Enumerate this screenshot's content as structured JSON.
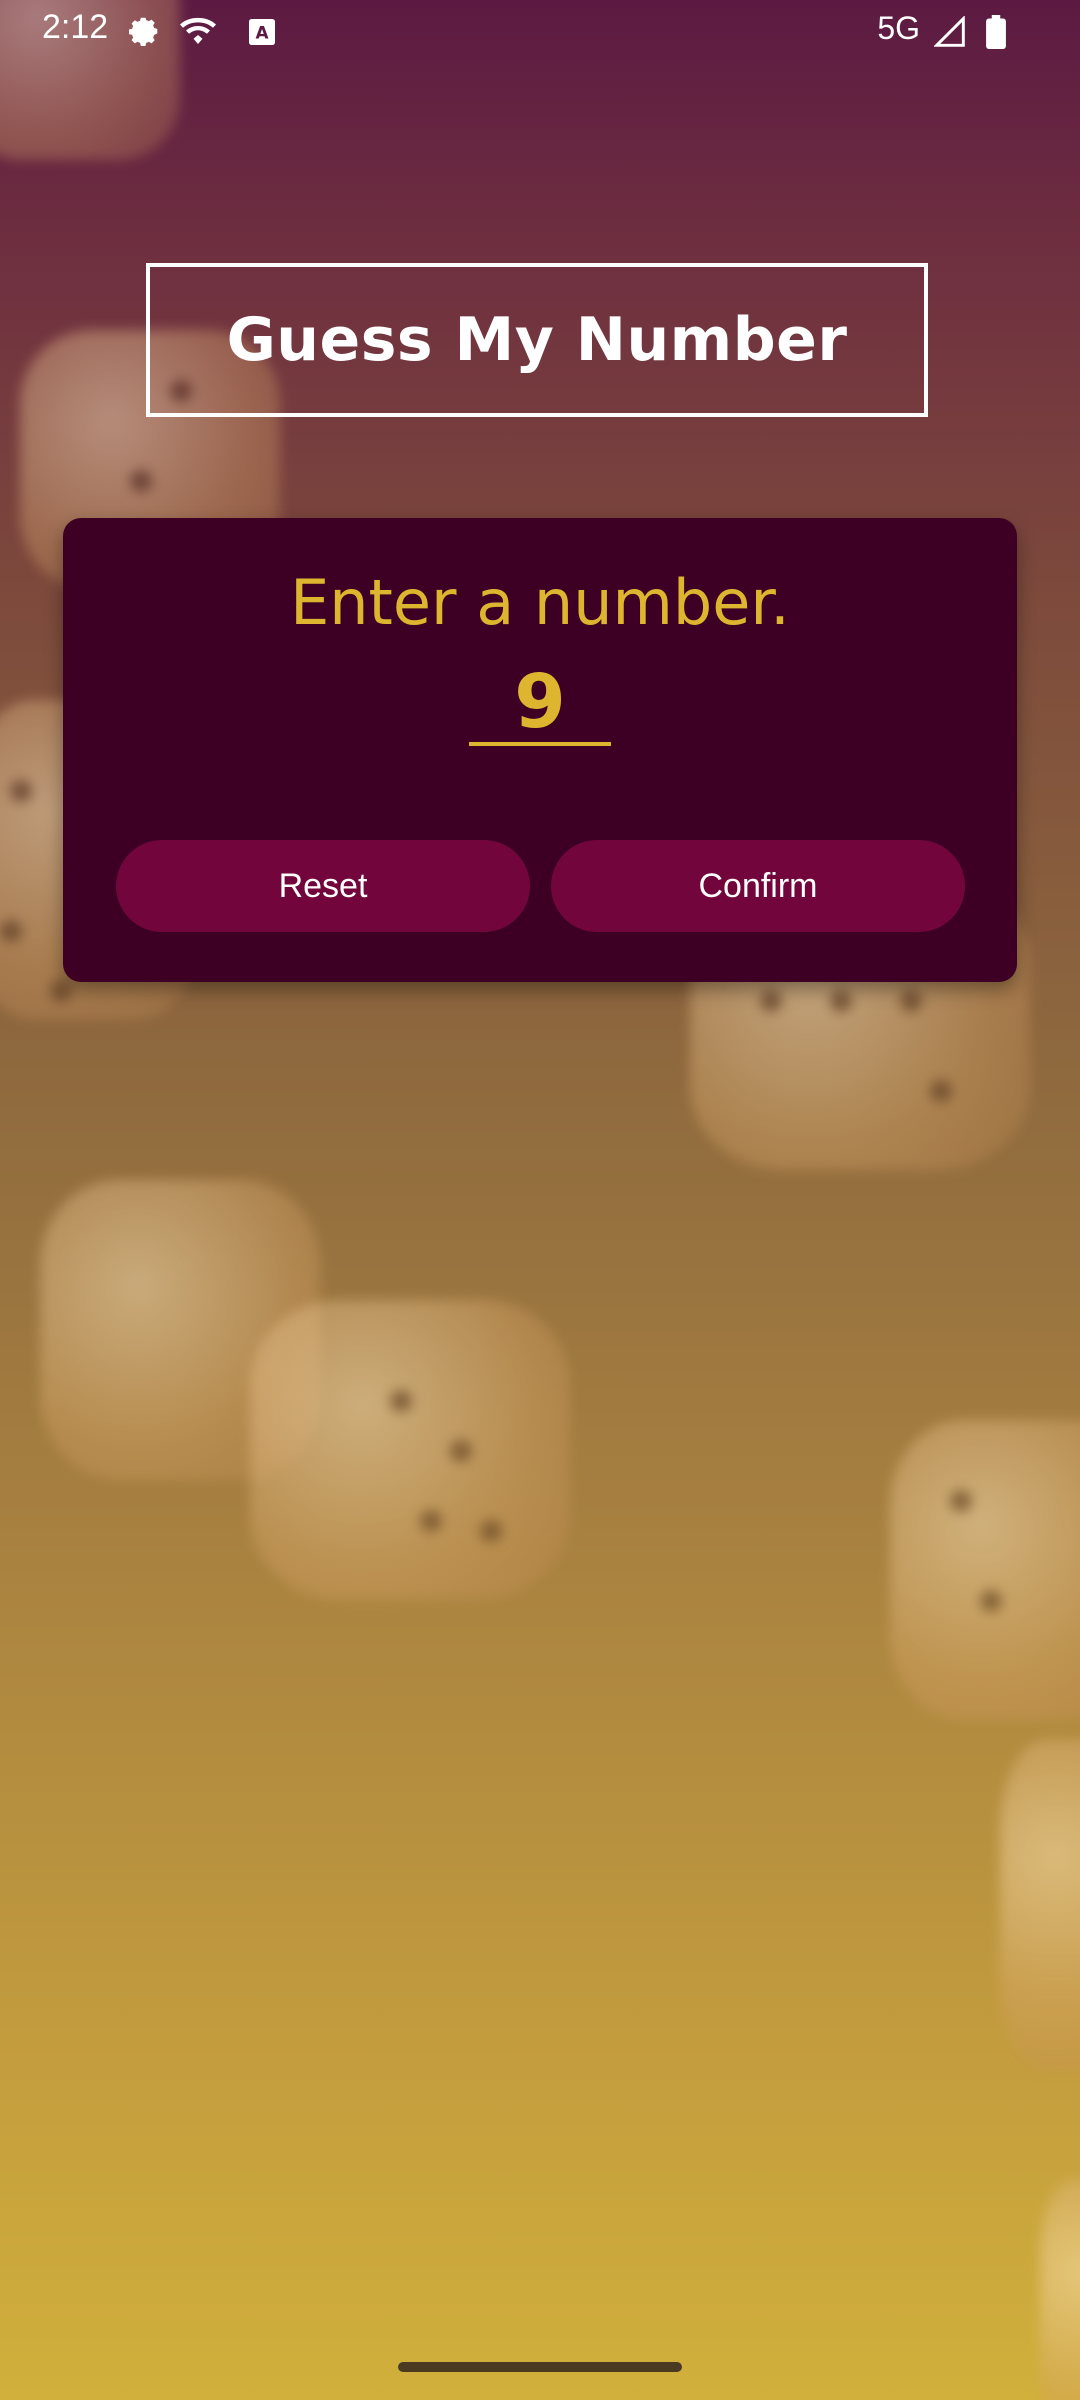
{
  "status_bar": {
    "time": "2:12",
    "network": "5G",
    "icons": [
      "settings-icon",
      "wifi-icon",
      "keyboard-icon",
      "signal-icon",
      "battery-icon"
    ]
  },
  "app": {
    "title": "Guess My Number"
  },
  "card": {
    "prompt": "Enter a number.",
    "input_value": "9",
    "reset_label": "Reset",
    "confirm_label": "Confirm"
  },
  "colors": {
    "accent": "#ddb52f",
    "card": "#3d0024",
    "button": "#72063c"
  }
}
